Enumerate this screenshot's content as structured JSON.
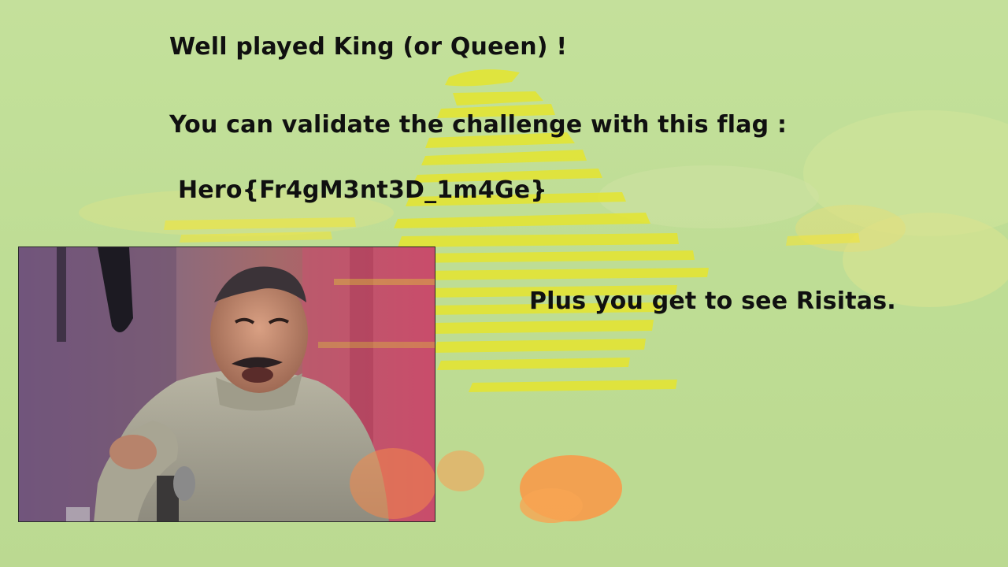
{
  "slide": {
    "heading": "Well played King (or Queen) !",
    "instruction": "You can validate the challenge with this flag :",
    "flag": "Hero{Fr4gM3nt3D_1m4Ge}",
    "note": "Plus you get to see Risitas."
  },
  "colors": {
    "background": "#c2df99",
    "streaks": "#e4e634",
    "orange_blobs": "#f79a4a",
    "text": "#101010"
  }
}
